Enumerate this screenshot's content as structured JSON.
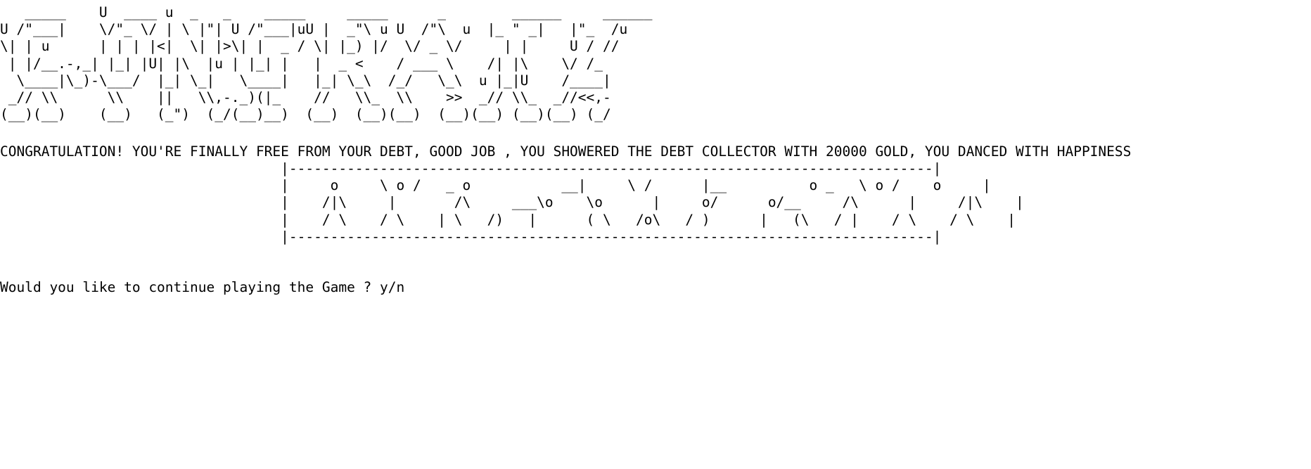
{
  "console": {
    "banner_art": "   _____    U  ____ u  _   _    _____     _____      _        ______     ______  \nU /\"___|    \\/\"_ \\/ | \\ |\"| U /\"___|uU |  _\"\\ u U  /\"\\  u  |_ \" _|   |\"_  /u \n\\| | u      | | | |<|  \\| |>\\| |  _ / \\| |_) |/  \\/ _ \\/     | |     U / //  \n | |/__.-,_| |_| |U| |\\  |u | |_| |   |  _ <    / ___ \\    /| |\\    \\/ /_  \n  \\____|\\_)-\\___/  |_| \\_|   \\____|   |_| \\_\\  /_/   \\_\\  u |_|U    /____| \n _// \\\\      \\\\    ||   \\\\,-._)(|_    //   \\\\_  \\\\    >>  _// \\\\_  _//<<,- \n(__)(__)    (__)   (_\")  (_/(__)__)  (__)  (__)(__)  (__)(__) (__)(__) (_/   ",
    "message": "CONGRATULATION! YOU'RE FINALLY FREE FROM YOUR DEBT, GOOD JOB , YOU SHOWERED THE DEBT COLLECTOR WITH 20000 GOLD, YOU DANCED WITH HAPPINESS",
    "dance_art": "                                  |------------------------------------------------------------------------------|\n                                  |     o     \\ o /   _ o           __|     \\ /      |__          o _   \\ o /    o     |\n                                  |    /|\\     |       /\\     ___\\o    \\o      |     o/      o/__     /\\      |     /|\\    |\n                                  |    / \\    / \\    | \\   /)   |      ( \\   /o\\   / )      |   (\\   / |    / \\    / \\    |\n                                  |------------------------------------------------------------------------------|",
    "prompt": "Would you like to continue playing the Game ? y/n"
  }
}
